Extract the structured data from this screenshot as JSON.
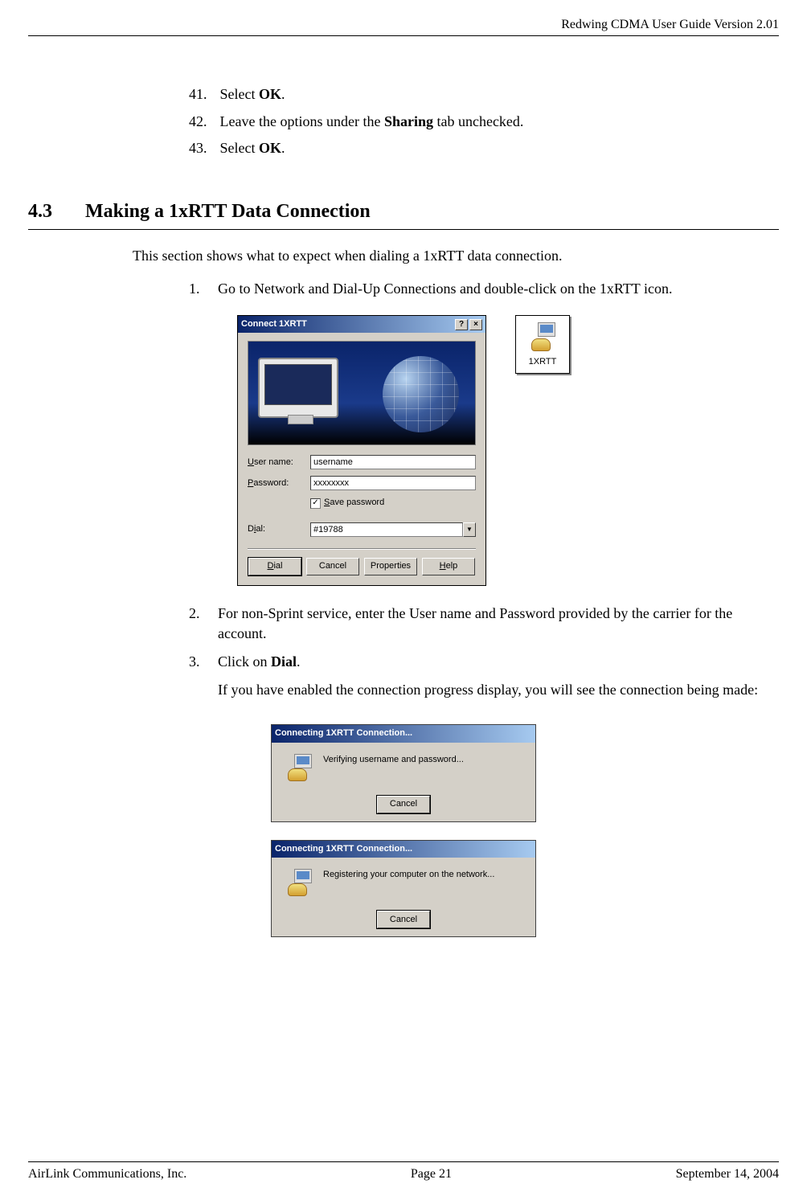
{
  "header": {
    "title": "Redwing CDMA User Guide Version 2.01"
  },
  "list_prev": [
    {
      "num": "41.",
      "prefix": "Select ",
      "bold": "OK",
      "suffix": "."
    },
    {
      "num": "42.",
      "prefix": "Leave the options under the ",
      "bold": "Sharing",
      "suffix": " tab unchecked."
    },
    {
      "num": "43.",
      "prefix": "Select ",
      "bold": "OK",
      "suffix": "."
    }
  ],
  "section": {
    "num": "4.3",
    "title": "Making a 1xRTT Data Connection"
  },
  "intro": "This section shows what to expect when dialing a 1xRTT data connection.",
  "steps": {
    "s1": {
      "num": "1.",
      "text": "Go to Network and Dial-Up Connections and double-click on the 1xRTT icon."
    },
    "s2": {
      "num": "2.",
      "text": "For non-Sprint service, enter the User name and Password provided by the carrier for the account."
    },
    "s3": {
      "num": "3.",
      "prefix": "Click on ",
      "bold": "Dial",
      "suffix": "."
    },
    "s3_cont": "If you have enabled the connection progress display, you will see the connection being made:"
  },
  "dialog_connect": {
    "title": "Connect 1XRTT",
    "username_label": "User name:",
    "password_label": "Password:",
    "dial_label": "Dial:",
    "save_password": "Save password",
    "username_value": "username",
    "password_value": "xxxxxxxx",
    "dial_value": "#19788",
    "btn_dial": "Dial",
    "btn_cancel": "Cancel",
    "btn_properties": "Properties",
    "btn_help": "Help"
  },
  "icon_1xrtt": {
    "label": "1XRTT"
  },
  "progress1": {
    "title": "Connecting 1XRTT Connection...",
    "message": "Verifying username and password...",
    "btn_cancel": "Cancel"
  },
  "progress2": {
    "title": "Connecting 1XRTT Connection...",
    "message": "Registering your computer on the network...",
    "btn_cancel": "Cancel"
  },
  "footer": {
    "left": "AirLink Communications, Inc.",
    "center": "Page 21",
    "right": "September 14, 2004"
  }
}
